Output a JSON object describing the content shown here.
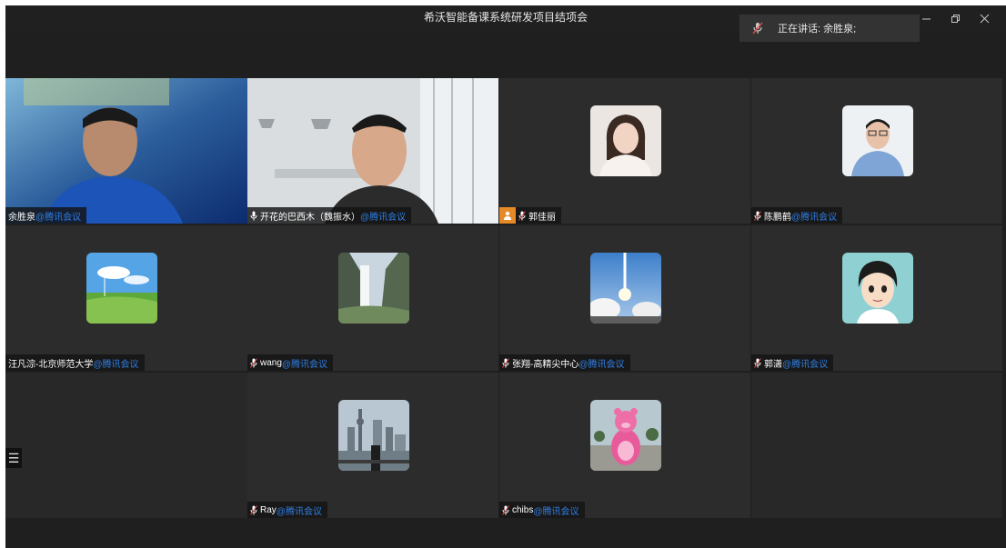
{
  "window": {
    "title": "希沃智能备课系统研发项目结项会",
    "controls": [
      "minimize-icon",
      "restore-icon",
      "close-icon"
    ]
  },
  "speaking": {
    "label": "正在讲话: 余胜泉;",
    "icon": "mic-muted-icon"
  },
  "brand_suffix": "@腾讯会议",
  "participants": [
    {
      "name": "余胜泉",
      "mic": "none",
      "video": "camera",
      "active": true
    },
    {
      "name": "开花的巴西木（魏振水）",
      "mic": "mic-on",
      "video": "camera"
    },
    {
      "name": "郭佳丽",
      "mic": "mic-muted",
      "host": true,
      "video": "avatar-photo-woman"
    },
    {
      "name": "陈鹏鹤",
      "mic": "mic-muted",
      "video": "avatar-photo-man"
    },
    {
      "name": "汪凡淙-北京师范大学",
      "mic": "none",
      "video": "avatar-landscape"
    },
    {
      "name": "wang",
      "mic": "mic-muted",
      "video": "avatar-waterfall"
    },
    {
      "name": "张翔-高精尖中心",
      "mic": "mic-muted",
      "video": "avatar-rocket"
    },
    {
      "name": "郭潇",
      "mic": "mic-muted",
      "video": "avatar-cartoon"
    },
    {
      "name": "Ray",
      "mic": "mic-muted",
      "video": "avatar-city"
    },
    {
      "name": "chibs",
      "mic": "mic-muted",
      "video": "avatar-bear"
    }
  ],
  "menu_glyph": "☰",
  "colors": {
    "background": "#1f1f1f",
    "tile": "#2c2c2c",
    "active_border": "#1ea672",
    "brand": "#2f7fe8",
    "host_badge": "#e58a27"
  }
}
